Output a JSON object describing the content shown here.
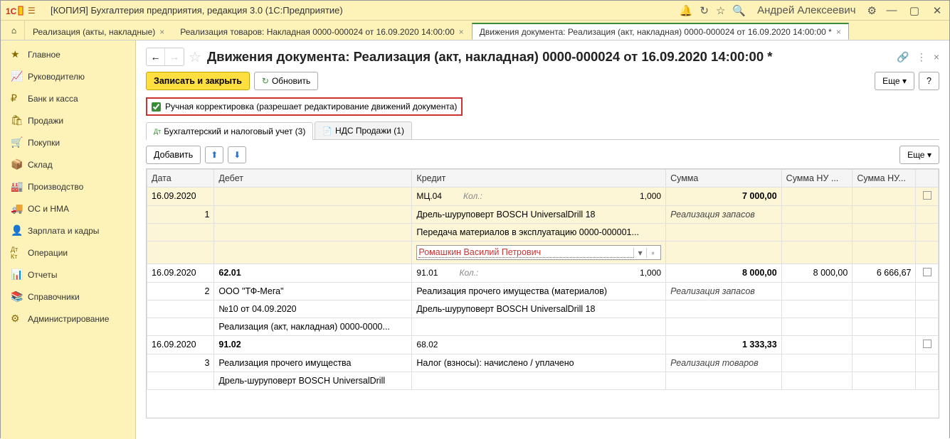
{
  "titlebar": {
    "app_title": "[КОПИЯ] Бухгалтерия предприятия, редакция 3.0  (1С:Предприятие)",
    "user": "Андрей Алексеевич"
  },
  "tabs": [
    "Реализация (акты, накладные)",
    "Реализация товаров: Накладная 0000-000024 от 16.09.2020 14:00:00",
    "Движения документа: Реализация (акт, накладная) 0000-000024 от 16.09.2020 14:00:00 *"
  ],
  "sidebar": {
    "items": [
      {
        "icon": "★",
        "label": "Главное"
      },
      {
        "icon": "📈",
        "label": "Руководителю"
      },
      {
        "icon": "₽",
        "label": "Банк и касса"
      },
      {
        "icon": "🛍",
        "label": "Продажи"
      },
      {
        "icon": "🛒",
        "label": "Покупки"
      },
      {
        "icon": "📦",
        "label": "Склад"
      },
      {
        "icon": "🏭",
        "label": "Производство"
      },
      {
        "icon": "🚚",
        "label": "ОС и НМА"
      },
      {
        "icon": "👤",
        "label": "Зарплата и кадры"
      },
      {
        "icon": "Дт",
        "label": "Операции"
      },
      {
        "icon": "📊",
        "label": "Отчеты"
      },
      {
        "icon": "📚",
        "label": "Справочники"
      },
      {
        "icon": "⚙",
        "label": "Администрирование"
      }
    ]
  },
  "page": {
    "title": "Движения документа: Реализация (акт, накладная) 0000-000024 от 16.09.2020 14:00:00 *",
    "btn_save": "Записать и закрыть",
    "btn_refresh": "Обновить",
    "btn_more": "Еще",
    "btn_help": "?",
    "checkbox_label": "Ручная корректировка (разрешает редактирование движений документа)",
    "inner_tabs": [
      "Бухгалтерский и налоговый учет (3)",
      "НДС Продажи (1)"
    ],
    "btn_add": "Добавить"
  },
  "columns": {
    "date": "Дата",
    "debit": "Дебет",
    "credit": "Кредит",
    "sum": "Сумма",
    "sum_nu1": "Сумма НУ ...",
    "sum_nu2": "Сумма НУ...",
    "check": ""
  },
  "qty_label": "Кол.:",
  "rows": [
    {
      "highlight": true,
      "date": "16.09.2020",
      "num": "1",
      "debit_account": "",
      "debit_lines": [
        "",
        "",
        ""
      ],
      "credit_account": "МЦ.04",
      "credit_qty": "1,000",
      "credit_lines": [
        "Дрель-шуруповерт BOSCH UniversalDrill 18",
        "Передача материалов в эксплуатацию 0000-000001..."
      ],
      "credit_edit": "Ромашкин Василий Петрович",
      "sum": "7 000,00",
      "sum_label": "Реализация запасов",
      "nu1": "",
      "nu2": ""
    },
    {
      "date": "16.09.2020",
      "num": "2",
      "debit_account": "62.01",
      "debit_lines": [
        "ООО \"ТФ-Мега\"",
        "№10 от 04.09.2020",
        "Реализация (акт, накладная) 0000-0000..."
      ],
      "credit_account": "91.01",
      "credit_qty": "1,000",
      "credit_lines": [
        "Реализация прочего имущества (материалов)",
        "Дрель-шуруповерт BOSCH UniversalDrill 18"
      ],
      "sum": "8 000,00",
      "sum_label": "Реализация запасов",
      "nu1": "8 000,00",
      "nu2": "6 666,67"
    },
    {
      "date": "16.09.2020",
      "num": "3",
      "debit_account": "91.02",
      "debit_lines": [
        "Реализация прочего имущества",
        "Дрель-шуруповерт BOSCH UniversalDrill"
      ],
      "credit_account": "68.02",
      "credit_qty": "",
      "credit_lines": [
        "Налог (взносы): начислено / уплачено"
      ],
      "sum": "1 333,33",
      "sum_label": "Реализация товаров",
      "nu1": "",
      "nu2": ""
    }
  ]
}
